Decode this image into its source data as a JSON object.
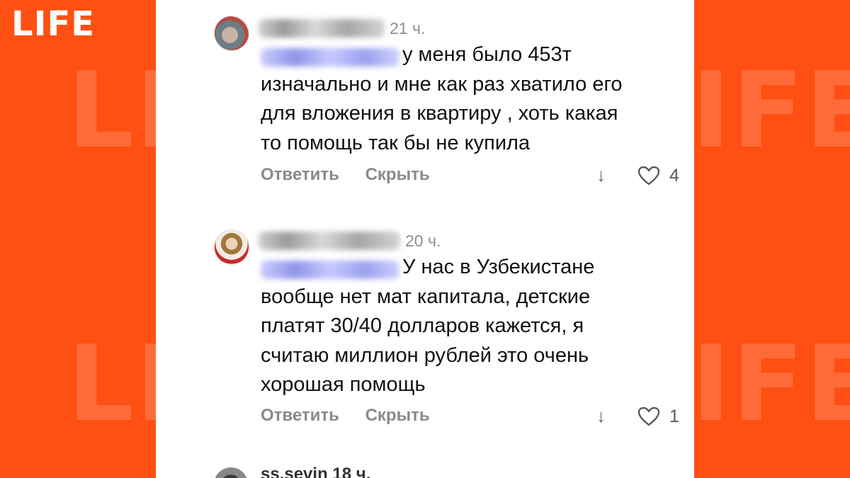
{
  "brand": {
    "logo": "LIFE",
    "watermark": "LIFE",
    "color": "#ff4f12"
  },
  "comments": [
    {
      "time": "21 ч.",
      "text": "у меня было 453т\nизначально и мне как раз хватило его\nдля вложения в квартиру , хоть какая\nто помощь так бы не купила",
      "reply_label": "Ответить",
      "hide_label": "Скрыть",
      "down_icon": "↓",
      "like_icon": "heart-outline",
      "likes": "4"
    },
    {
      "time": "20 ч.",
      "text": "У нас в Узбекистане\nвообще нет мат капитала, детские\nплатят 30/40 долларов кажется, я\nсчитаю миллион рублей это очень\nхорошая помощь",
      "reply_label": "Ответить",
      "hide_label": "Скрыть",
      "down_icon": "↓",
      "like_icon": "heart-outline",
      "likes": "1"
    }
  ],
  "next_comment": {
    "username": "ss.sevin 18 ч."
  }
}
